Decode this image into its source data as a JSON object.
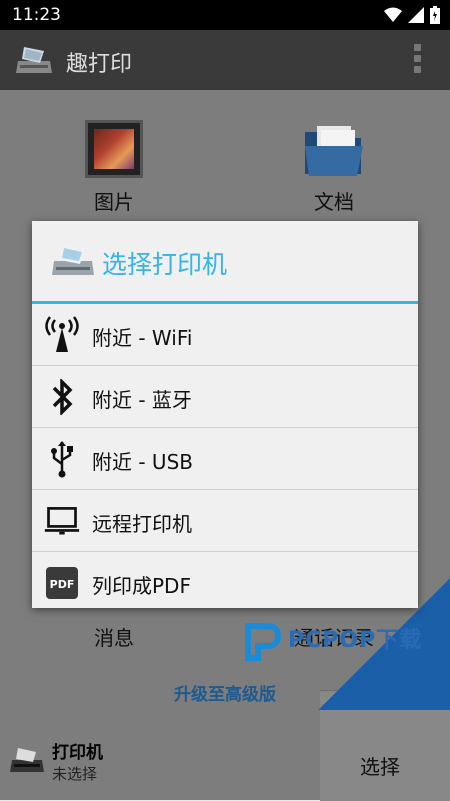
{
  "status_bar": {
    "time": "11:23"
  },
  "app": {
    "title": "趣打印"
  },
  "grid": [
    {
      "label": "图片",
      "icon": "picture-icon"
    },
    {
      "label": "文档",
      "icon": "folder-icon"
    },
    {
      "label": "消息",
      "icon": "message-icon"
    },
    {
      "label": "通话记录",
      "icon": "call-log-icon"
    }
  ],
  "upgrade_label": "升级至高级版",
  "printer": {
    "label": "打印机",
    "state": "未选择",
    "select_label": "选择"
  },
  "watermark": {
    "text": "PCPOP下载"
  },
  "dialog": {
    "title": "选择打印机",
    "options": [
      {
        "label": "附近 - WiFi",
        "icon": "wifi-antenna-icon"
      },
      {
        "label": "附近 - 蓝牙",
        "icon": "bluetooth-icon"
      },
      {
        "label": "附近 - USB",
        "icon": "usb-icon"
      },
      {
        "label": "远程打印机",
        "icon": "laptop-icon"
      },
      {
        "label": "列印成PDF",
        "icon": "pdf-icon"
      }
    ]
  },
  "colors": {
    "accent": "#33b5e5",
    "upgrade": "#1e5a8e",
    "watermark": "#1b5fa8"
  }
}
